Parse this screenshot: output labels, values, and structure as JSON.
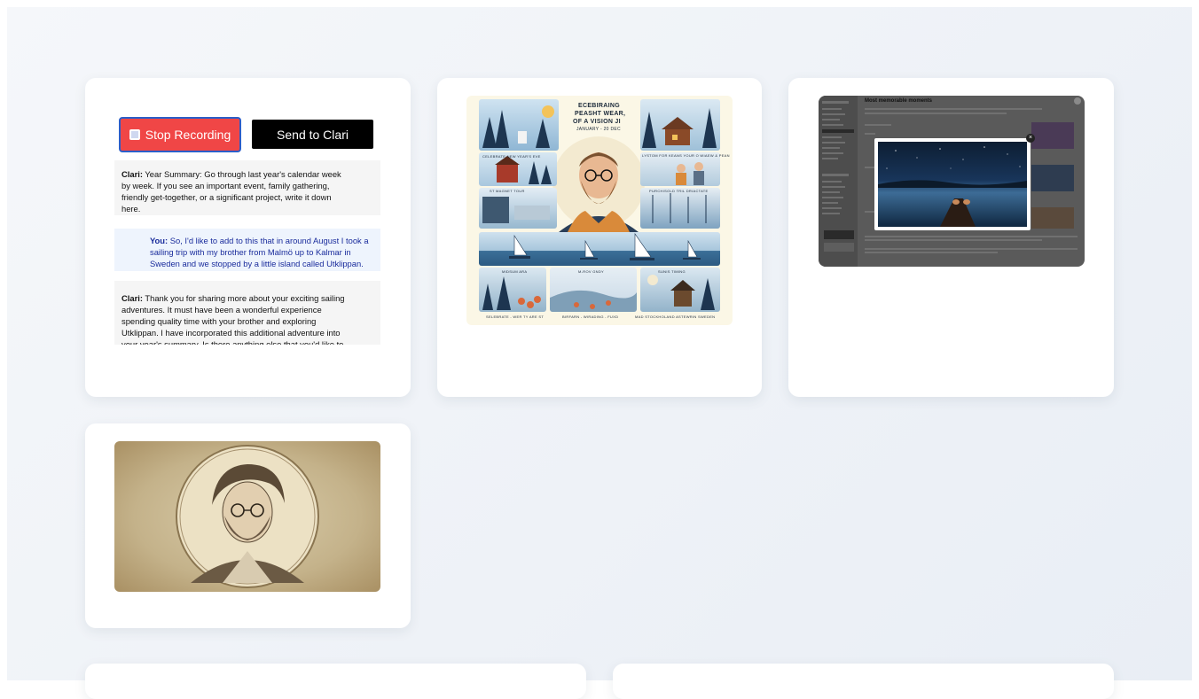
{
  "chat_card": {
    "stop_button": "Stop Recording",
    "send_button": "Send to Clari",
    "messages": [
      {
        "speaker": "Clari:",
        "text": "Year Summary: Go through last year's calendar week by week. If you see an important event, family gathering, friendly get-together, or a significant project, write it down here."
      },
      {
        "speaker": "You:",
        "text": "So, I'd like to add to this that in around August I took a sailing trip with my brother from Malmö up to Kalmar in Sweden and we stopped by a little island called Utklippan."
      },
      {
        "speaker": "Clari:",
        "text": "Thank you for sharing more about your exciting sailing adventures. It must have been a wonderful experience spending quality time with your brother and exploring Utklippan. I have incorporated this additional adventure into your year's summary. Is there anything else that you'd like to add?"
      }
    ]
  },
  "poster_card": {
    "title_lines": [
      "ECEBIRAING",
      "PEASHT WEAR,",
      "OF A VISION JI"
    ],
    "subtitle": "JANUARY - 20 DEC",
    "labels": {
      "new_year": "CELEBRATE NEW YEAR'S EVE",
      "cabin": "ST MAGNET TOUR",
      "friends": "LYSTOM FOR KEANS YOUR O WIAEW & PEAN",
      "harbor": "PURCHISOLD TRIL DRIACTATE",
      "bottom_left": "MIDSUM ARA",
      "bottom_mid": "M-ROV GNDY",
      "bottom_right": "SUNIS TIMING",
      "footer_left": "SELEBRATE - WER TY ARE ST",
      "footer_mid": "BIRFARN - WIRADING - FUXD",
      "footer_right": "MAD STOCKHOLAND ASTEWRIN SWEDEN"
    }
  },
  "screenshot_card": {
    "heading": "Most memorable moments",
    "close_glyph": "×"
  },
  "colors": {
    "stop_red": "#f04646",
    "stop_border": "#2b5ec9",
    "send_black": "#000000",
    "user_text_blue": "#1a2c9c",
    "user_bubble": "#eef4fd",
    "clari_bubble": "#f5f5f5"
  }
}
